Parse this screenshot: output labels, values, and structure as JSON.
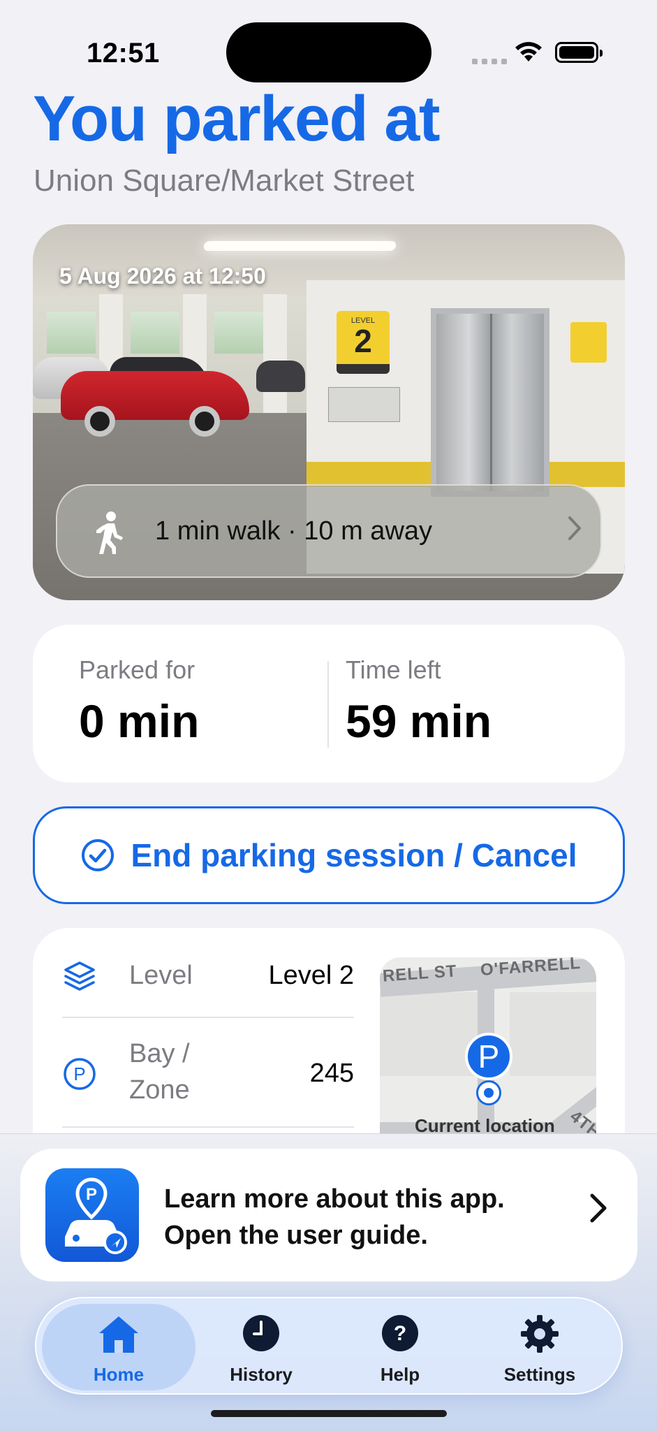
{
  "status_bar": {
    "time": "12:51"
  },
  "header": {
    "title": "You parked at",
    "location": "Union Square/Market Street"
  },
  "photo": {
    "timestamp": "5 Aug 2026 at 12:50",
    "sign_level_label": "LEVEL",
    "sign_level_number": "2"
  },
  "walk": {
    "text": "1 min walk · 10 m away"
  },
  "stats": {
    "parked_for_label": "Parked for",
    "parked_for_value": "0 min",
    "time_left_label": "Time left",
    "time_left_value": "59 min"
  },
  "end_button": {
    "label": "End parking session / Cancel"
  },
  "details": {
    "level_label": "Level",
    "level_value": "Level 2",
    "bay_label_line1": "Bay /",
    "bay_label_line2": "Zone",
    "bay_value": "245"
  },
  "map": {
    "street_1": "RELL ST",
    "street_2": "O'FARRELL",
    "street_3": "4TH",
    "pin_letter": "P",
    "current_location": "Current location"
  },
  "guide": {
    "line1": "Learn more about this app.",
    "line2": "Open the user guide."
  },
  "tabs": [
    {
      "label": "Home",
      "icon": "house-icon",
      "active": true
    },
    {
      "label": "History",
      "icon": "clock-icon",
      "active": false
    },
    {
      "label": "Help",
      "icon": "question-icon",
      "active": false
    },
    {
      "label": "Settings",
      "icon": "gear-icon",
      "active": false
    }
  ],
  "colors": {
    "accent": "#1669e6",
    "background": "#f1f1f6"
  }
}
